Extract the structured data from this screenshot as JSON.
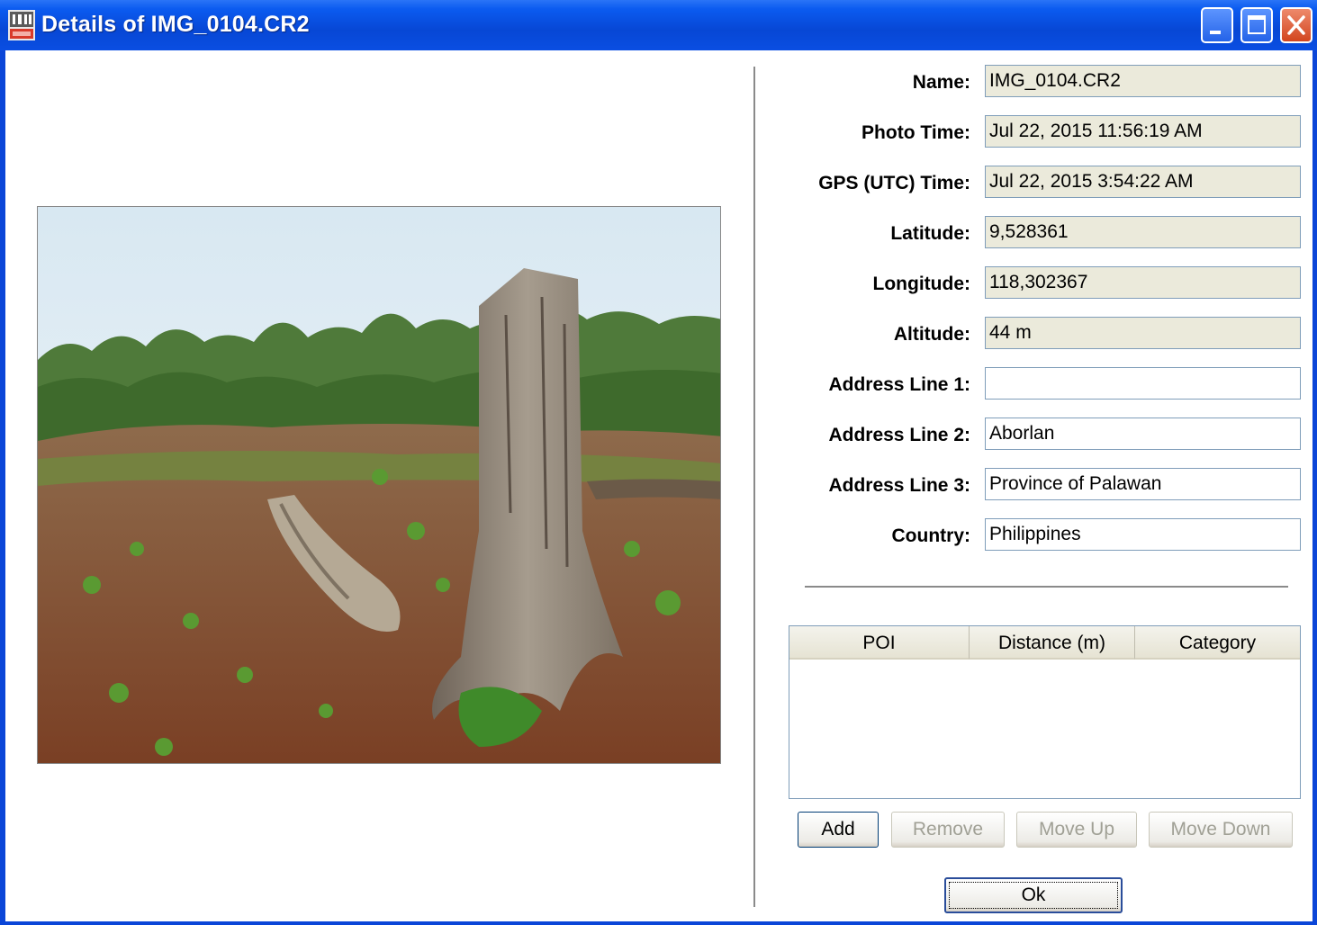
{
  "window": {
    "title": "Details of IMG_0104.CR2",
    "icon": "jobo-gps-app-icon",
    "controls": [
      "minimize-icon",
      "maximize-icon",
      "close-icon"
    ]
  },
  "fields": [
    {
      "label": "Name:",
      "value": "IMG_0104.CR2",
      "readonly": true
    },
    {
      "label": "Photo Time:",
      "value": "Jul 22, 2015 11:56:19 AM",
      "readonly": true
    },
    {
      "label": "GPS (UTC) Time:",
      "value": "Jul 22, 2015 3:54:22 AM",
      "readonly": true
    },
    {
      "label": "Latitude:",
      "value": "9,528361",
      "readonly": true
    },
    {
      "label": "Longitude:",
      "value": "118,302367",
      "readonly": true
    },
    {
      "label": "Altitude:",
      "value": "44 m",
      "readonly": true
    },
    {
      "label": "Address Line 1:",
      "value": "",
      "readonly": false
    },
    {
      "label": "Address Line 2:",
      "value": "Aborlan",
      "readonly": false
    },
    {
      "label": "Address Line 3:",
      "value": "Province of Palawan",
      "readonly": false
    },
    {
      "label": "Country:",
      "value": "Philippines",
      "readonly": false
    }
  ],
  "poi_table": {
    "columns": [
      "POI",
      "Distance (m)",
      "Category"
    ],
    "rows": []
  },
  "buttons": {
    "add": "Add",
    "remove": "Remove",
    "move_up": "Move Up",
    "move_down": "Move Down",
    "ok": "Ok"
  },
  "colors": {
    "titlebar": "#0b5bf0",
    "readonly_field": "#ebeadb",
    "field_border": "#7f9db9",
    "close_button": "#d2451f"
  }
}
